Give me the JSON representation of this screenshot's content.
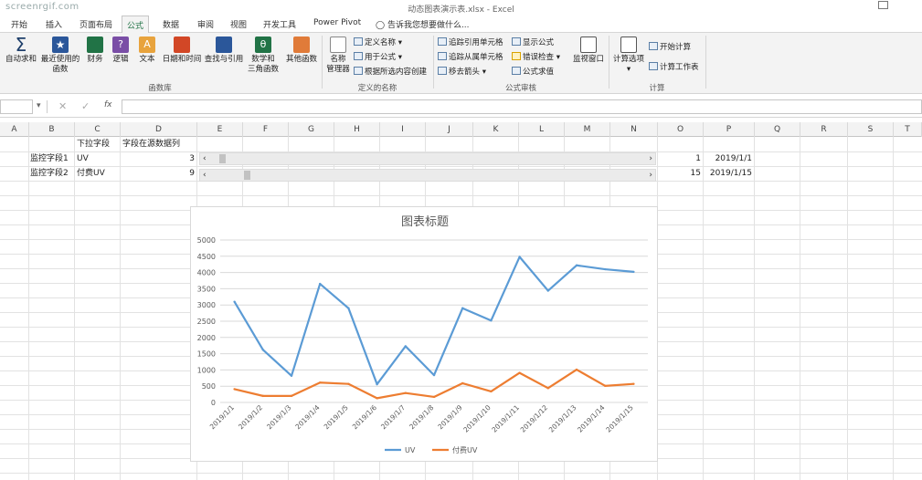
{
  "app": {
    "watermark": "screenrgif.com",
    "doc_title": "动态图表演示表.xlsx - Excel"
  },
  "tabs": [
    "开始",
    "插入",
    "页面布局",
    "公式",
    "数据",
    "审阅",
    "视图",
    "开发工具",
    "Power Pivot"
  ],
  "active_tab": "公式",
  "tell_me": "告诉我您想要做什么...",
  "ribbon": {
    "lib": [
      {
        "l1": "自动求和",
        "l2": "",
        "icon": "sigma-icon",
        "color": "#1f3f6b"
      },
      {
        "l1": "最近使用的",
        "l2": "函数",
        "icon": "star-icon",
        "color": "#2b579a"
      },
      {
        "l1": "财务",
        "l2": "",
        "icon": "finance-book-icon",
        "color": "#217346"
      },
      {
        "l1": "逻辑",
        "l2": "",
        "icon": "logic-book-icon",
        "color": "#7a4ea6"
      },
      {
        "l1": "文本",
        "l2": "",
        "icon": "text-book-icon",
        "color": "#e8a33d"
      },
      {
        "l1": "日期和时间",
        "l2": "",
        "icon": "date-book-icon",
        "color": "#d24726"
      },
      {
        "l1": "查找与引用",
        "l2": "",
        "icon": "lookup-book-icon",
        "color": "#2b579a"
      },
      {
        "l1": "数学和",
        "l2": "三角函数",
        "icon": "math-book-icon",
        "color": "#217346"
      },
      {
        "l1": "其他函数",
        "l2": "",
        "icon": "more-functions-icon",
        "color": "#e07b39"
      }
    ],
    "lib_group": "函数库",
    "name_manager": {
      "l1": "名称",
      "l2": "管理器"
    },
    "names": [
      "定义名称",
      "用于公式",
      "根据所选内容创建"
    ],
    "names_group": "定义的名称",
    "audit": [
      "追踪引用单元格",
      "追踪从属单元格",
      "移去箭头",
      "显示公式",
      "错误检查",
      "公式求值"
    ],
    "watch": "监视窗口",
    "audit_group": "公式审核",
    "calc_options": "计算选项",
    "calc": [
      "开始计算",
      "计算工作表"
    ],
    "calc_group": "计算"
  },
  "formula_bar": {
    "fx": "fx",
    "value": ""
  },
  "columns": [
    "A",
    "B",
    "C",
    "D",
    "E",
    "F",
    "G",
    "H",
    "I",
    "J",
    "K",
    "L",
    "M",
    "N",
    "O",
    "P",
    "Q",
    "R",
    "S",
    "T"
  ],
  "cells": {
    "c1": "下拉字段",
    "d1": "字段在源数据列",
    "b2": "监控字段1",
    "c2": "UV",
    "d2": "3",
    "o2": "1",
    "p2": "2019/1/1",
    "b3": "监控字段2",
    "c3": "付费UV",
    "d3": "9",
    "o3": "15",
    "p3": "2019/1/15"
  },
  "scrollbars": [
    {
      "position": 0.01
    },
    {
      "position": 0.07
    }
  ],
  "chart_data": {
    "type": "line",
    "title": "图表标题",
    "categories": [
      "2019/1/1",
      "2019/1/2",
      "2019/1/3",
      "2019/1/4",
      "2019/1/5",
      "2019/1/6",
      "2019/1/7",
      "2019/1/8",
      "2019/1/9",
      "2019/1/10",
      "2019/1/11",
      "2019/1/12",
      "2019/1/13",
      "2019/1/14",
      "2019/1/15"
    ],
    "series": [
      {
        "name": "UV",
        "color": "#5b9bd5",
        "values": [
          3100,
          1620,
          820,
          3650,
          2900,
          560,
          1730,
          840,
          2900,
          2520,
          4480,
          3440,
          4220,
          4100,
          4020
        ]
      },
      {
        "name": "付费UV",
        "color": "#ed7d31",
        "values": [
          410,
          200,
          200,
          610,
          570,
          130,
          290,
          170,
          590,
          340,
          910,
          440,
          1010,
          510,
          570
        ]
      }
    ],
    "ylim": [
      0,
      5000
    ],
    "yticks": [
      0,
      500,
      1000,
      1500,
      2000,
      2500,
      3000,
      3500,
      4000,
      4500,
      5000
    ],
    "grid": true,
    "legend": "bottom"
  }
}
